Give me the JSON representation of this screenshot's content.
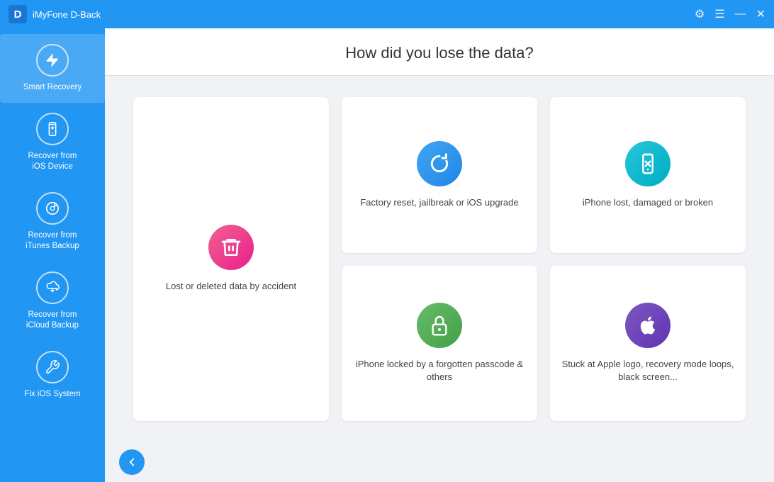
{
  "titleBar": {
    "appIcon": "D",
    "title": "iMyFone D-Back",
    "controls": {
      "settings": "⚙",
      "menu": "☰",
      "minimize": "—",
      "close": "✕"
    }
  },
  "sidebar": {
    "items": [
      {
        "id": "smart-recovery",
        "label": "Smart Recovery",
        "icon": "⚡",
        "active": true
      },
      {
        "id": "recover-ios",
        "label": "Recover from\niOS Device",
        "icon": "📱",
        "active": false
      },
      {
        "id": "recover-itunes",
        "label": "Recover from\niTunes Backup",
        "icon": "♪",
        "active": false
      },
      {
        "id": "recover-icloud",
        "label": "Recover from\niCloud Backup",
        "icon": "↓",
        "active": false
      },
      {
        "id": "fix-ios",
        "label": "Fix iOS System",
        "icon": "🔧",
        "active": false
      }
    ]
  },
  "content": {
    "heading": "How did you lose the data?",
    "cards": [
      {
        "id": "lost-deleted",
        "label": "Lost or deleted data by accident",
        "iconColor": "pink",
        "icon": "🗑",
        "big": true
      },
      {
        "id": "factory-reset",
        "label": "Factory reset, jailbreak or iOS upgrade",
        "iconColor": "blue",
        "icon": "↺",
        "big": false
      },
      {
        "id": "iphone-lost",
        "label": "iPhone lost, damaged or broken",
        "iconColor": "teal",
        "icon": "📵",
        "big": false
      },
      {
        "id": "iphone-locked",
        "label": "iPhone locked by a forgotten passcode & others",
        "iconColor": "green",
        "icon": "🔒",
        "big": false
      },
      {
        "id": "stuck-apple",
        "label": "Stuck at Apple logo, recovery mode loops, black screen...",
        "iconColor": "purple",
        "icon": "",
        "big": false
      }
    ],
    "backButton": "←"
  }
}
